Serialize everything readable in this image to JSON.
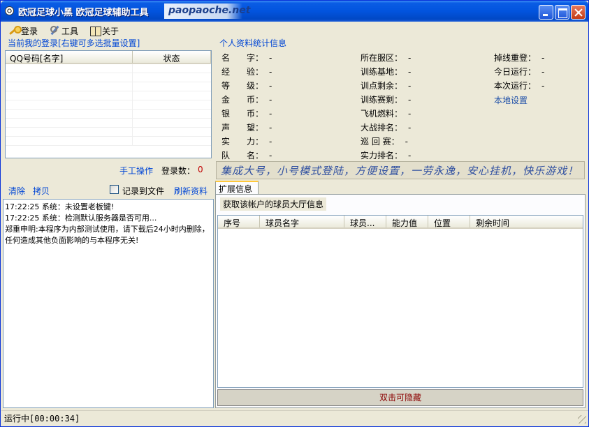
{
  "window": {
    "title": "欧冠足球小黑 欧冠足球辅助工具",
    "brand": "paopaoche.net"
  },
  "menu": [
    {
      "label": "登录",
      "icon": "key-icon"
    },
    {
      "label": "工具",
      "icon": "tool-icon"
    },
    {
      "label": "关于",
      "icon": "book-icon"
    }
  ],
  "login_panel": {
    "caption": "当前我的登录[右键可多选批量设置]",
    "columns": [
      "QQ号码[名字]",
      "状态"
    ],
    "manual_op": "手工操作",
    "login_count_label": "登录数：",
    "login_count": "0"
  },
  "log_toolbar": {
    "clear": "清除",
    "copy": "拷贝",
    "record_to_file": "记录到文件",
    "refresh": "刷新资料"
  },
  "log_lines": [
    "17:22:25 系统：未设置老板键!",
    "17:22:25 系统：检测默认服务器是否可用...",
    "郑重申明:本程序为内部测试使用，请下载后24小时内删除，任何造成其他负面影响的与本程序无关!"
  ],
  "stats": {
    "caption": "个人资料统计信息",
    "col1": [
      {
        "label": "名　　字：",
        "value": "-"
      },
      {
        "label": "经　　验：",
        "value": "-"
      },
      {
        "label": "等　　级：",
        "value": "-"
      },
      {
        "label": "金　　币：",
        "value": "-"
      },
      {
        "label": "银　　币：",
        "value": "-"
      },
      {
        "label": "声　　望：",
        "value": "-"
      },
      {
        "label": "实　　力：",
        "value": "-"
      },
      {
        "label": "队　　名：",
        "value": "-"
      }
    ],
    "col2": [
      {
        "label": "所在服区：",
        "value": "-"
      },
      {
        "label": "训练基地：",
        "value": "-"
      },
      {
        "label": "训点剩余：",
        "value": "-"
      },
      {
        "label": "训练赛剩：",
        "value": "-"
      },
      {
        "label": "飞机燃料：",
        "value": "-"
      },
      {
        "label": "大战排名：",
        "value": "-"
      },
      {
        "label": "巡 回 赛：",
        "value": "-"
      },
      {
        "label": "实力排名：",
        "value": "-"
      }
    ],
    "col3": [
      {
        "label": "掉线重登：",
        "value": "-"
      },
      {
        "label": "今日运行：",
        "value": "-"
      },
      {
        "label": "本次运行：",
        "value": "-"
      }
    ],
    "local_settings": "本地设置"
  },
  "banner": "集成大号，小号模式登陆，方便设置，一劳永逸，安心挂机，快乐游戏！",
  "tabs": [
    {
      "label": "扩展信息",
      "active": true
    }
  ],
  "ext_panel": {
    "description": "获取该帐户的球员大厅信息",
    "columns": [
      "序号",
      "球员名字",
      "球员...",
      "能力值",
      "位置",
      "剩余时间"
    ],
    "hide_label": "双击可隐藏"
  },
  "status": {
    "text": "运行中[00:00:34]"
  }
}
